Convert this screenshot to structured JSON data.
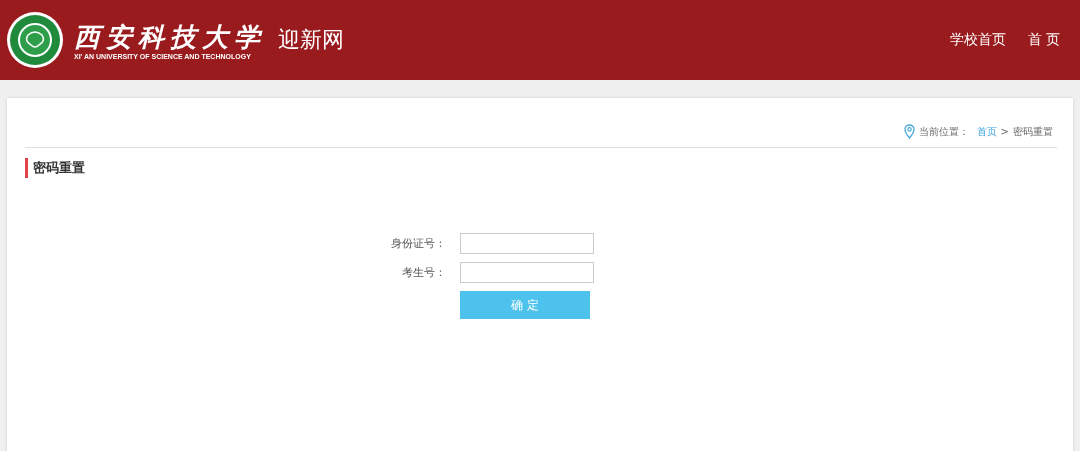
{
  "header": {
    "school_name": "西安科技大学",
    "school_name_en": "XI' AN UNIVERSITY  OF SCIENCE AND TECHNOLOGY",
    "site_name": "迎新网",
    "nav": [
      {
        "label": "学校首页"
      },
      {
        "label": "首 页"
      }
    ]
  },
  "breadcrumb": {
    "prefix": "当前位置：",
    "items": [
      {
        "label": "首页",
        "kind": "link"
      },
      {
        "label": ">",
        "kind": "separator"
      },
      {
        "label": "密码重置",
        "kind": "current"
      }
    ]
  },
  "section_title": "密码重置",
  "form": {
    "fields": [
      {
        "label": "身份证号："
      },
      {
        "label": "考生号："
      }
    ],
    "submit": "确 定"
  }
}
